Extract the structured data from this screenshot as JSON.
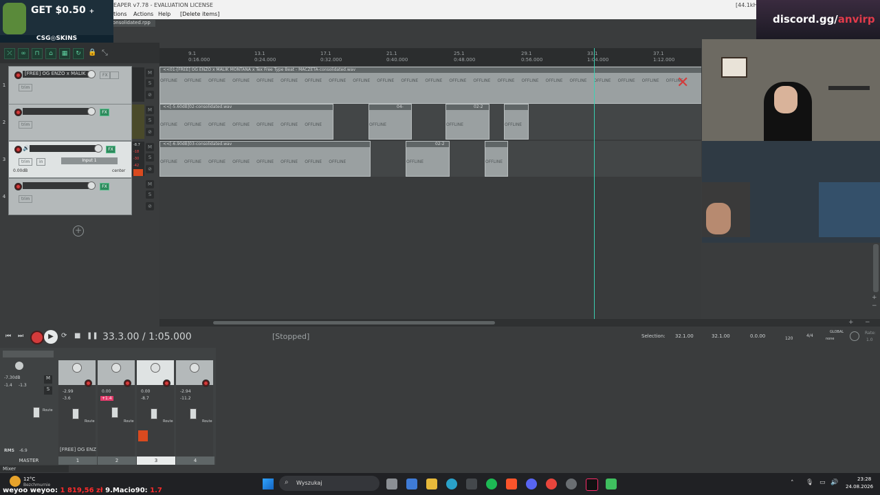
{
  "window": {
    "title": "EAPER v7.78 - EVALUATION LICENSE",
    "rate_info": "[44.1kHz",
    "project_tab": "onsolidated.rpp"
  },
  "menu": {
    "items": [
      "tions",
      "Actions",
      "Help",
      "[Delete items]"
    ]
  },
  "overlay": {
    "csgo_text": "GET $0.50",
    "csgo_plus": "+",
    "csgo_brand": "CSG◎SKINS",
    "discord_text": "discord.gg/",
    "discord_user": "anvirp"
  },
  "ruler": {
    "marks": [
      {
        "bar": "9.1",
        "time": "0:16.000"
      },
      {
        "bar": "13.1",
        "time": "0:24.000"
      },
      {
        "bar": "17.1",
        "time": "0:32.000"
      },
      {
        "bar": "21.1",
        "time": "0:40.000"
      },
      {
        "bar": "25.1",
        "time": "0:48.000"
      },
      {
        "bar": "29.1",
        "time": "0:56.000"
      },
      {
        "bar": "33.1",
        "time": "1:04.000"
      },
      {
        "bar": "37.1",
        "time": "1:12.000"
      }
    ]
  },
  "tracks": [
    {
      "num": "1",
      "name": "[FREE] OG ENZO x MALIK",
      "trim": "trim"
    },
    {
      "num": "2",
      "name": "",
      "trim": "trim"
    },
    {
      "num": "3",
      "name": "",
      "trim": "trim",
      "input": "Input 1",
      "in_label": "in",
      "vol": "0.00dB",
      "pan": "center",
      "meter_vals": [
        "-8.7",
        "-18",
        "-30",
        "-42",
        "-54"
      ]
    },
    {
      "num": "4",
      "name": "",
      "trim": "trim"
    }
  ],
  "items": {
    "track1_label": "<<01-[FREE] OG ENZO x MALIK MONTANA x Tex Free Type Beat - MACZETA-consolidated.wav",
    "track2_label": "<<[-5.60dB]02-consolidated.wav",
    "track2_b": "04-",
    "track2_c": "02-2",
    "track3_label": "<<[-6.90dB]03-consolidated.wav",
    "track3_b": "02-2",
    "offline": "OFFLINE"
  },
  "transport": {
    "timecode": "33.3.00 / 1:05.000",
    "status": "[Stopped]",
    "selection_label": "Selection:",
    "sel_start": "32.1.00",
    "sel_end": "32.1.00",
    "sel_len": "0.0.00",
    "bpm": "120",
    "timesig": "4/4",
    "global": "GLOBAL",
    "none": "none",
    "rate_label": "Rate:",
    "rate_val": "1.0"
  },
  "mixer": {
    "master_label": "MASTER",
    "master_db": "-7.30dB",
    "master_peaks": [
      "-1.4",
      "-1.3"
    ],
    "rms_label": "RMS",
    "rms_val": "-6.9",
    "channels": [
      {
        "num": "1",
        "name": "[FREE] OG ENZ",
        "db": "-2.99",
        "peak": "-3.6"
      },
      {
        "num": "2",
        "name": "",
        "db": "0.00",
        "peak": "+1.4"
      },
      {
        "num": "3",
        "name": "",
        "db": "0.00",
        "peak": "-8.7"
      },
      {
        "num": "4",
        "name": "",
        "db": "-2.94",
        "peak": "-11.2"
      }
    ],
    "mixer_tab": "Mixer",
    "route": "Route"
  },
  "taskbar": {
    "weather_temp": "12°C",
    "weather_desc": "Bezchmurnie",
    "search_placeholder": "Wyszukaj",
    "time": "23:28",
    "date": "24.08.2026",
    "donation_ticker_a": "weyoo weyoo:",
    "donation_amount_a": "1 819,56 zł",
    "donation_ticker_b": "9.Macio90:",
    "donation_amount_b": "1.7"
  },
  "colors": {
    "accent": "#3ad1b3",
    "record": "#d43b3b",
    "fx": "#2d8a5c",
    "donation": "#ff2b2b"
  }
}
